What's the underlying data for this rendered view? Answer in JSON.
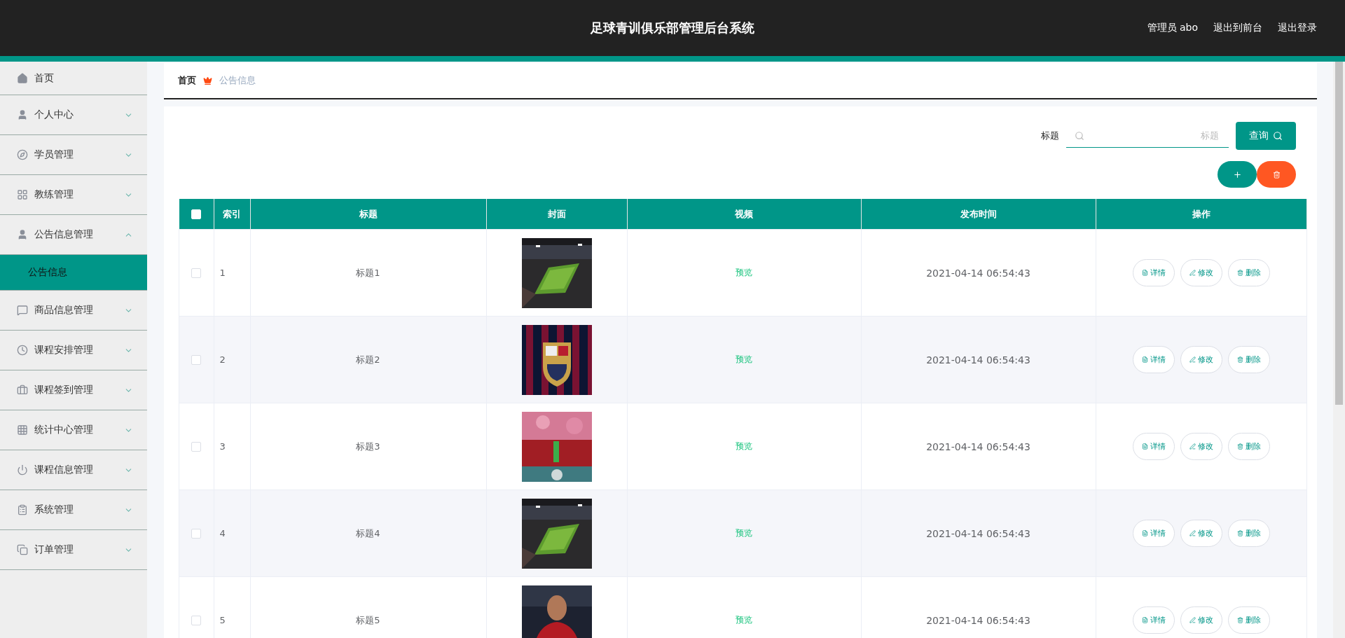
{
  "header": {
    "title": "足球青训俱乐部管理后台系统",
    "links": [
      "管理员 abo",
      "退出到前台",
      "退出登录"
    ]
  },
  "sidebar": {
    "items": [
      {
        "label": "首页",
        "kind": "link"
      },
      {
        "label": "个人中心",
        "kind": "group",
        "expanded": false
      },
      {
        "label": "学员管理",
        "kind": "group",
        "expanded": false
      },
      {
        "label": "教练管理",
        "kind": "group",
        "expanded": false
      },
      {
        "label": "公告信息管理",
        "kind": "group",
        "expanded": true,
        "children": [
          {
            "label": "公告信息",
            "selected": true
          }
        ]
      },
      {
        "label": "商品信息管理",
        "kind": "group",
        "expanded": false
      },
      {
        "label": "课程安排管理",
        "kind": "group",
        "expanded": false
      },
      {
        "label": "课程签到管理",
        "kind": "group",
        "expanded": false
      },
      {
        "label": "统计中心管理",
        "kind": "group",
        "expanded": false
      },
      {
        "label": "课程信息管理",
        "kind": "group",
        "expanded": false
      },
      {
        "label": "系统管理",
        "kind": "group",
        "expanded": false
      },
      {
        "label": "订单管理",
        "kind": "group",
        "expanded": false
      }
    ]
  },
  "breadcrumb": [
    "首页",
    "公告信息"
  ],
  "search": {
    "label": "标题",
    "placeholder": "标题",
    "button": "查询"
  },
  "table": {
    "header_checked": false,
    "columns": [
      "索引",
      "标题",
      "封面",
      "视频",
      "发布时间",
      "操作"
    ],
    "rows": [
      {
        "checked": false,
        "index": "1",
        "title": "标题1",
        "video": "预览",
        "time": "2021-04-14 06:54:43",
        "actions": [
          "详情",
          "修改",
          "删除"
        ]
      },
      {
        "checked": false,
        "index": "2",
        "title": "标题2",
        "video": "预览",
        "time": "2021-04-14 06:54:43",
        "actions": [
          "详情",
          "修改",
          "删除"
        ]
      },
      {
        "checked": false,
        "index": "3",
        "title": "标题3",
        "video": "预览",
        "time": "2021-04-14 06:54:43",
        "actions": [
          "详情",
          "修改",
          "删除"
        ]
      },
      {
        "checked": false,
        "index": "4",
        "title": "标题4",
        "video": "预览",
        "time": "2021-04-14 06:54:43",
        "actions": [
          "详情",
          "修改",
          "删除"
        ]
      },
      {
        "checked": false,
        "index": "5",
        "title": "标题5",
        "video": "预览",
        "time": "2021-04-14 06:54:43",
        "actions": [
          "详情",
          "修改",
          "删除"
        ]
      }
    ]
  }
}
